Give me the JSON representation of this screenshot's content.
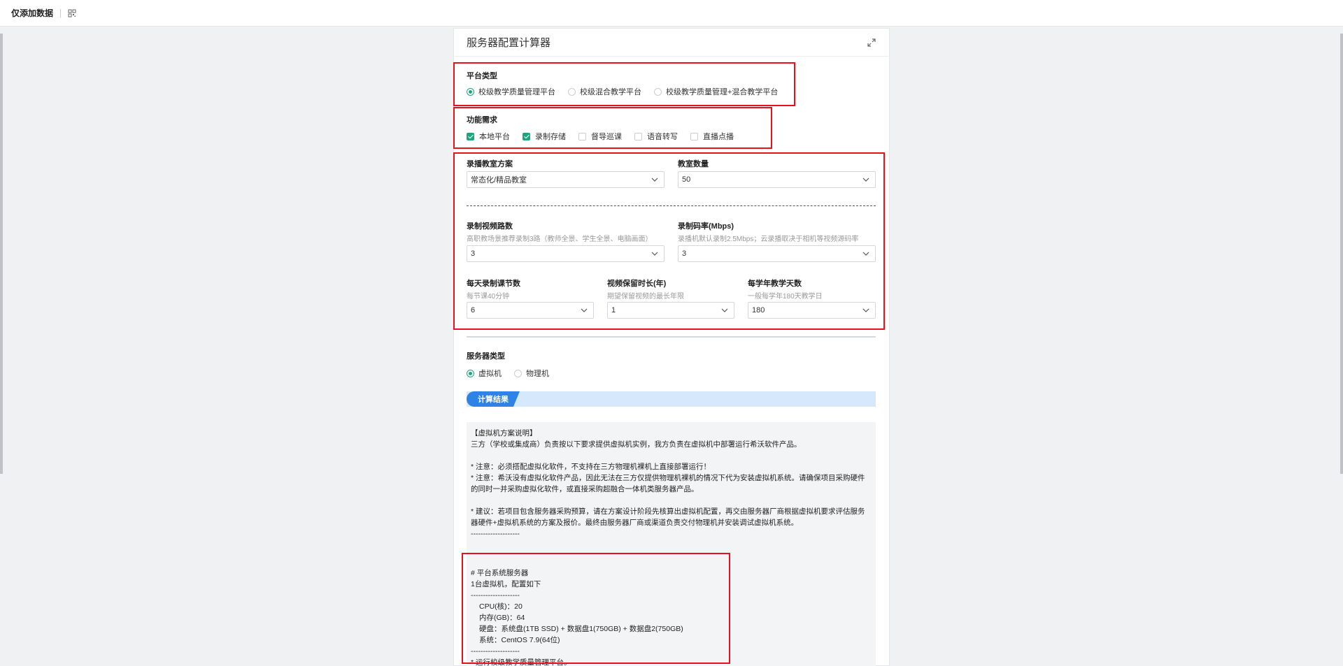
{
  "topbar": {
    "title": "仅添加数据",
    "qr_icon": "qr-icon"
  },
  "panel": {
    "title": "服务器配置计算器",
    "expand_icon": "expand-icon"
  },
  "platform": {
    "label": "平台类型",
    "options": [
      {
        "label": "校级教学质量管理平台",
        "selected": true
      },
      {
        "label": "校级混合教学平台",
        "selected": false
      },
      {
        "label": "校级教学质量管理+混合教学平台",
        "selected": false
      }
    ]
  },
  "features": {
    "label": "功能需求",
    "options": [
      {
        "label": "本地平台",
        "checked": true
      },
      {
        "label": "录制存储",
        "checked": true
      },
      {
        "label": "督导巡课",
        "checked": false
      },
      {
        "label": "语音转写",
        "checked": false
      },
      {
        "label": "直播点播",
        "checked": false
      }
    ]
  },
  "classroom_scheme": {
    "label": "录播教室方案",
    "value": "常态化/精品教室"
  },
  "classroom_count": {
    "label": "教室数量",
    "value": "50"
  },
  "video_channels": {
    "label": "录制视频路数",
    "hint": "高职教场景推荐录制3路（教师全景、学生全景、电脑画面）",
    "value": "3"
  },
  "bitrate": {
    "label": "录制码率(Mbps)",
    "hint": "录播机默认录制2.5Mbps；云录播取决于相机等视频源码率",
    "value": "3"
  },
  "daily_lessons": {
    "label": "每天录制课节数",
    "hint": "每节课40分钟",
    "value": "6"
  },
  "retention": {
    "label": "视频保留时长(年)",
    "hint": "期望保留视频的最长年限",
    "value": "1"
  },
  "teaching_days": {
    "label": "每学年教学天数",
    "hint": "一般每学年180天教学日",
    "value": "180"
  },
  "server_type": {
    "label": "服务器类型",
    "options": [
      {
        "label": "虚拟机",
        "selected": true
      },
      {
        "label": "物理机",
        "selected": false
      }
    ]
  },
  "result_tab": "计算结果",
  "result": {
    "l1": "【虚拟机方案说明】",
    "l2": "三方（学校或集成商）负责按以下要求提供虚拟机实例，我方负责在虚拟机中部署运行希沃软件产品。",
    "l3": "* 注意：必须搭配虚拟化软件，不支持在三方物理机裸机上直接部署运行！",
    "l4": "* 注意：希沃没有虚拟化软件产品，因此无法在三方仅提供物理机裸机的情况下代为安装虚拟机系统。请确保项目采购硬件的同时一并采购虚拟化软件，或直接采购超融合一体机类服务器产品。",
    "l5": "* 建议：若项目包含服务器采购预算，请在方案设计阶段先核算出虚拟机配置，再交由服务器厂商根据虚拟机要求评估服务器硬件+虚拟机系统的方案及报价。最终由服务器厂商或渠道负责交付物理机并安装调试虚拟机系统。",
    "l6": "--------------------",
    "l7": "# 平台系统服务器",
    "l8": "1台虚拟机，配置如下",
    "l9": "--------------------",
    "l10": "CPU(核)：20",
    "l11": "内存(GB)：64",
    "l12": "硬盘：系统盘(1TB SSD) + 数据盘1(750GB) + 数据盘2(750GB)",
    "l13": "系统：CentOS 7.9(64位)",
    "l14": "--------------------",
    "l15": "* 运行校级教学质量管理平台。"
  },
  "colors": {
    "accent": "#1aa67f",
    "tab_blue": "#2f83e6",
    "highlight": "#e8101a"
  }
}
